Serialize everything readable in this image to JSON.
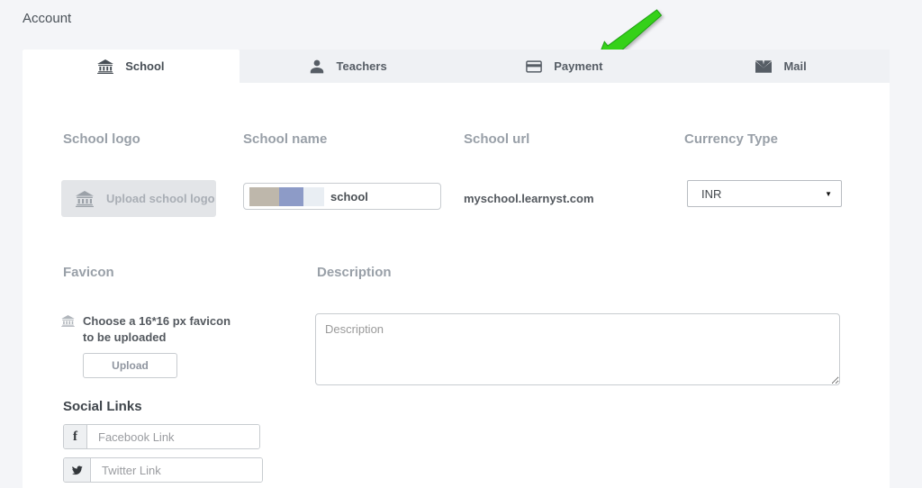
{
  "page": {
    "title": "Account"
  },
  "tabs": [
    {
      "label": "School",
      "icon": "bank-icon",
      "active": true
    },
    {
      "label": "Teachers",
      "icon": "person-icon",
      "active": false
    },
    {
      "label": "Payment",
      "icon": "credit-card-icon",
      "active": false
    },
    {
      "label": "Mail",
      "icon": "envelope-icon",
      "active": false
    }
  ],
  "form": {
    "school_logo": {
      "label": "School logo",
      "upload_button_label": "Upload school logo",
      "icon": "bank-icon"
    },
    "school_name": {
      "label": "School name",
      "value": "school"
    },
    "school_url": {
      "label": "School url",
      "value": "myschool.learnyst.com"
    },
    "currency": {
      "label": "Currency Type",
      "selected_option": "INR",
      "caret": "▼"
    },
    "favicon": {
      "label": "Favicon",
      "note": "Choose a 16*16 px favicon to be uploaded",
      "upload_button_label": "Upload",
      "icon": "bank-icon"
    },
    "description": {
      "label": "Description",
      "placeholder": "Description"
    },
    "social": {
      "label": "Social Links",
      "facebook": {
        "icon_glyph": "f",
        "placeholder": "Facebook Link"
      },
      "twitter": {
        "icon": "twitter-bird-icon",
        "placeholder": "Twitter Link"
      }
    }
  },
  "annotation": {
    "type": "green-arrow",
    "points_at": "Payment tab"
  },
  "colors": {
    "page_bg": "#f4f5f8",
    "tabbar_bg": "#eff1f4",
    "card_bg": "#ffffff",
    "arrow_green": "#35d119",
    "arrow_green_dark": "#1d9e12",
    "redacted_block_1": "#beb7ab",
    "redacted_block_2": "#8d9bc7"
  }
}
